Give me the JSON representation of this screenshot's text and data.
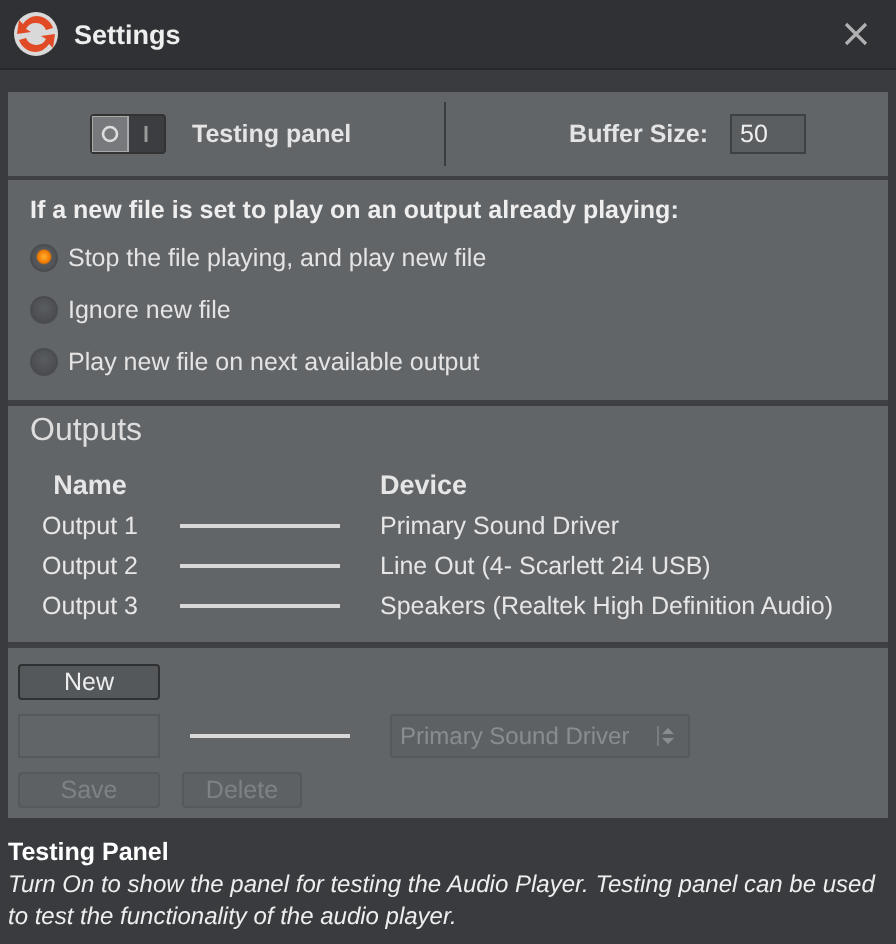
{
  "window": {
    "title": "Settings"
  },
  "testing_panel": {
    "label": "Testing panel",
    "on": false
  },
  "buffer_size": {
    "label": "Buffer Size:",
    "value": "50"
  },
  "conflict_policy": {
    "prompt": "If a new file is set to play on an output already playing:",
    "options": [
      {
        "label": "Stop the file playing, and play new file",
        "selected": true
      },
      {
        "label": "Ignore new file",
        "selected": false
      },
      {
        "label": "Play new file on next available output",
        "selected": false
      }
    ]
  },
  "outputs": {
    "title": "Outputs",
    "columns": [
      "Name",
      "Device"
    ],
    "rows": [
      {
        "name": "Output 1",
        "device": "Primary Sound Driver"
      },
      {
        "name": "Output 2",
        "device": "Line Out (4- Scarlett 2i4 USB)"
      },
      {
        "name": "Output 3",
        "device": "Speakers (Realtek High Definition Audio)"
      }
    ]
  },
  "editor": {
    "new_button": "New",
    "device_select": "Primary Sound Driver",
    "save_button": "Save",
    "delete_button": "Delete",
    "disabled": true
  },
  "help": {
    "title": "Testing Panel",
    "text": "Turn On to show the panel for testing the Audio Player. Testing panel can be used to test the functionality of the audio player."
  }
}
